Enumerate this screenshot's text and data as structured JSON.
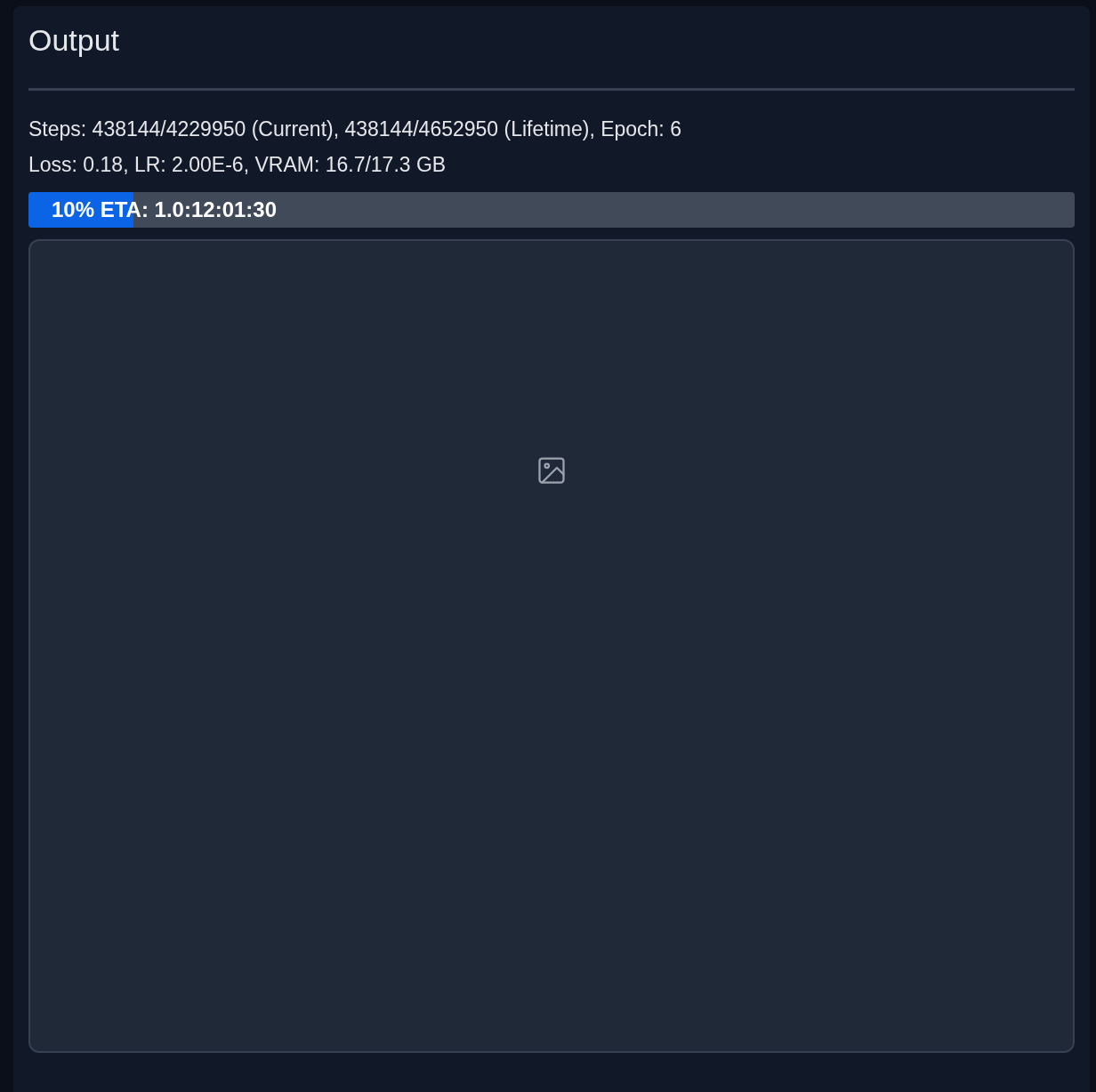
{
  "title": "Output",
  "status_lines": [
    "Steps: 438144/4229950 (Current), 438144/4652950 (Lifetime), Epoch: 6",
    "Loss: 0.18, LR: 2.00E-6, VRAM: 16.7/17.3 GB"
  ],
  "progress": {
    "level": 0.1,
    "label": "10% ETA: 1.0:12:01:30"
  },
  "image_output": {
    "empty": true
  }
}
